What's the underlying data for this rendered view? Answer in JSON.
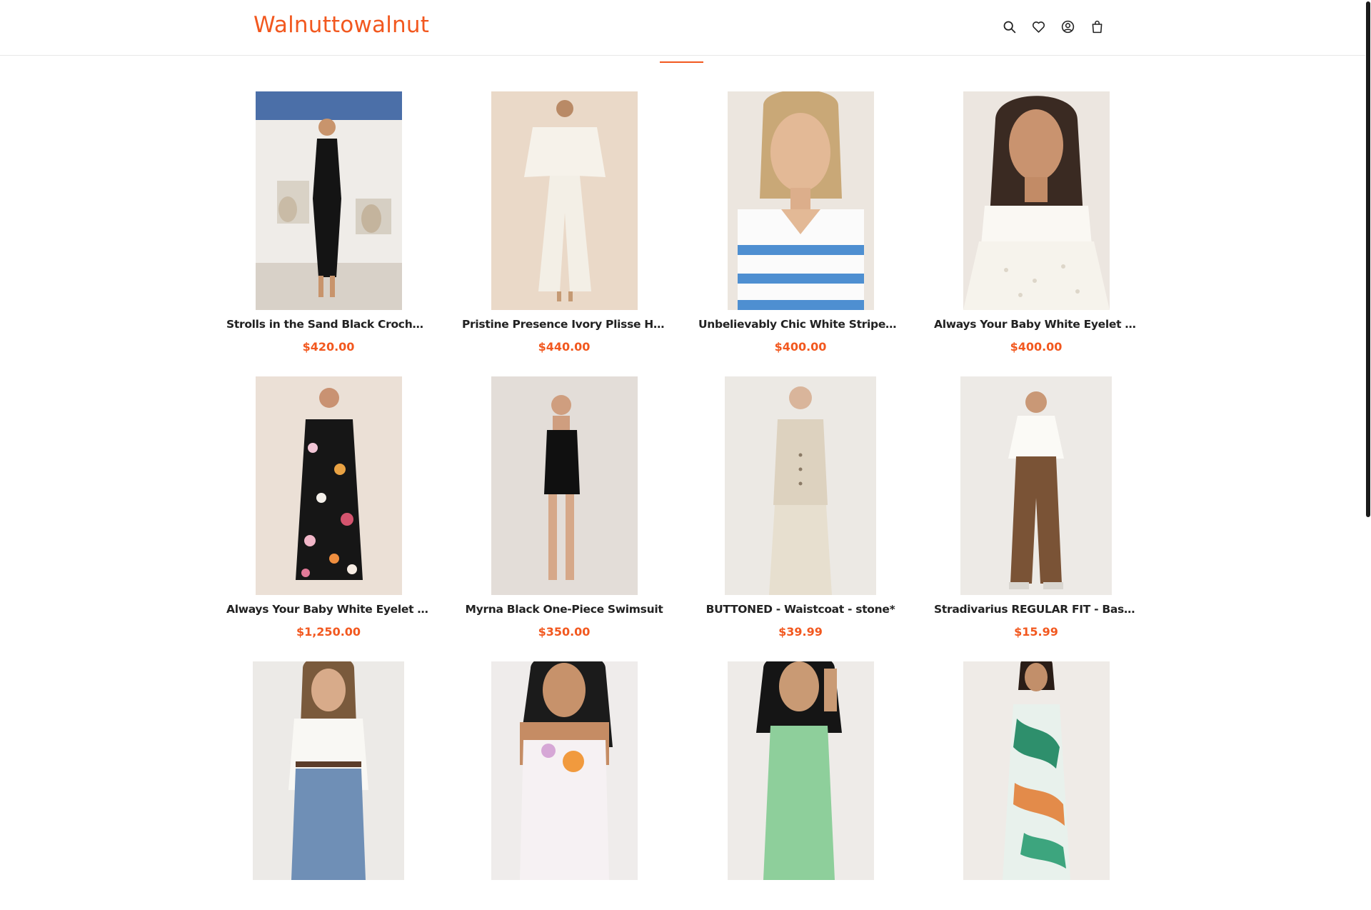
{
  "header": {
    "logo": "Walnuttowalnut",
    "icons": [
      "search-icon",
      "wishlist-heart-icon",
      "account-icon",
      "cart-bag-icon"
    ],
    "accent_color": "#f2581f"
  },
  "products": [
    {
      "title": "Strolls in the Sand Black Crochet Midi Dress",
      "price": "$420.00"
    },
    {
      "title": "Pristine Presence Ivory Plisse High-Waisted Pants",
      "price": "$440.00"
    },
    {
      "title": "Unbelievably Chic White Striped Collared Top",
      "price": "$400.00"
    },
    {
      "title": "Always Your Baby White Eyelet Babydoll Top",
      "price": "$400.00"
    },
    {
      "title": "Always Your Baby White Eyelet Babydoll Dress",
      "price": "$1,250.00"
    },
    {
      "title": "Myrna Black One-Piece Swimsuit",
      "price": "$350.00"
    },
    {
      "title": "BUTTONED - Waistcoat - stone*",
      "price": "$39.99"
    },
    {
      "title": "Stradivarius REGULAR FIT - Basic T-shirt",
      "price": "$15.99"
    },
    {
      "title": "",
      "price": ""
    },
    {
      "title": "",
      "price": ""
    },
    {
      "title": "",
      "price": ""
    },
    {
      "title": "",
      "price": ""
    }
  ]
}
